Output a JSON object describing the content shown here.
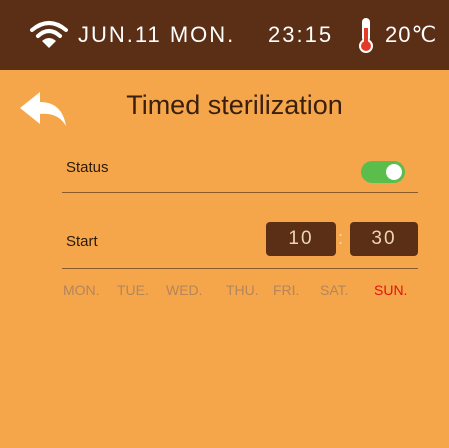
{
  "status_bar": {
    "wifi_icon": "wifi-icon",
    "date": "JUN.11 MON.",
    "time": "23:15",
    "thermometer_icon": "thermometer-icon",
    "temperature": "20℃"
  },
  "header": {
    "back_icon": "back-arrow-icon",
    "title": "Timed sterilization"
  },
  "status_row": {
    "label": "Status",
    "toggle_on": true
  },
  "start_row": {
    "label": "Start",
    "hour": "10",
    "separator": ":",
    "minute": "30"
  },
  "days": [
    {
      "label": "MON.",
      "active": false
    },
    {
      "label": "TUE.",
      "active": false
    },
    {
      "label": "WED.",
      "active": false
    },
    {
      "label": "THU.",
      "active": false
    },
    {
      "label": "FRI.",
      "active": false
    },
    {
      "label": "SAT.",
      "active": false
    },
    {
      "label": "SUN.",
      "active": true
    }
  ],
  "colors": {
    "background": "#f5a64a",
    "status_bar": "#5a2f16",
    "toggle_on": "#5bbd4b",
    "active_day": "#e0140f",
    "inactive_day": "#b4855a"
  }
}
